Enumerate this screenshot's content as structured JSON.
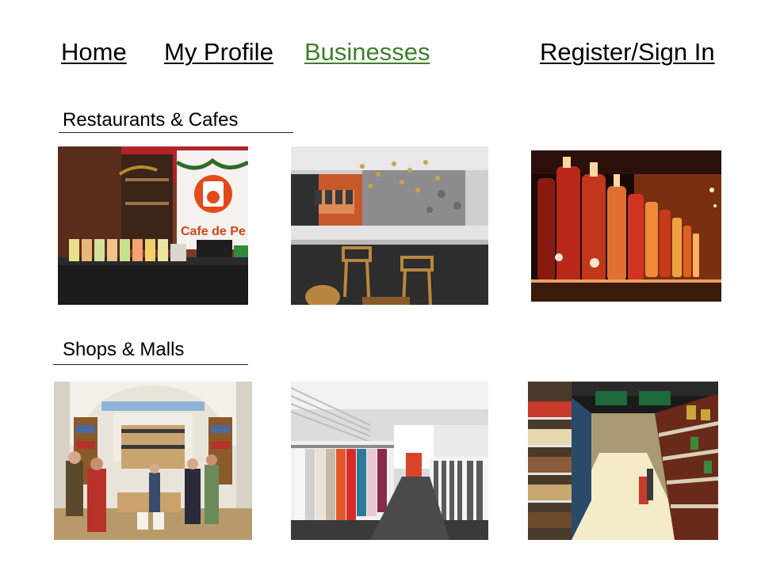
{
  "nav": {
    "home": "Home",
    "profile": "My Profile",
    "businesses": "Businesses",
    "register": "Register/Sign In",
    "active_color": "#3f7f2a"
  },
  "sections": {
    "restaurants": {
      "title": "Restaurants & Cafes",
      "sign_text": "Cafe de Pe"
    },
    "shops": {
      "title": "Shops & Malls"
    }
  }
}
